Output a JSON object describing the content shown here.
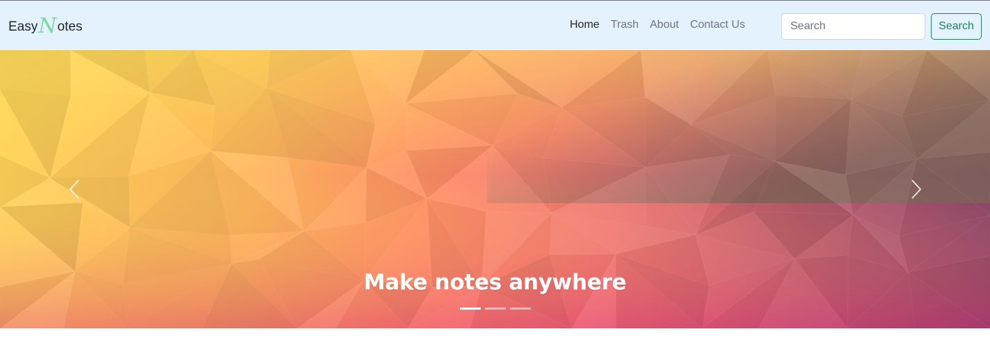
{
  "brand": {
    "prefix": "Easy",
    "letter": "N",
    "suffix": "otes"
  },
  "nav": {
    "links": [
      {
        "label": "Home",
        "active": true
      },
      {
        "label": "Trash"
      },
      {
        "label": "About"
      },
      {
        "label": "Contact Us"
      }
    ]
  },
  "search": {
    "placeholder": "Search",
    "value": "",
    "button_label": "Search"
  },
  "carousel": {
    "caption": "Make notes anywhere",
    "slide_count": 3,
    "active_index": 0
  },
  "colors": {
    "navbar_bg": "#e3f2fd",
    "brand_accent": "#7ed6a3",
    "search_button": "#198754"
  },
  "icons": {
    "prev": "chevron-left-icon",
    "next": "chevron-right-icon"
  }
}
